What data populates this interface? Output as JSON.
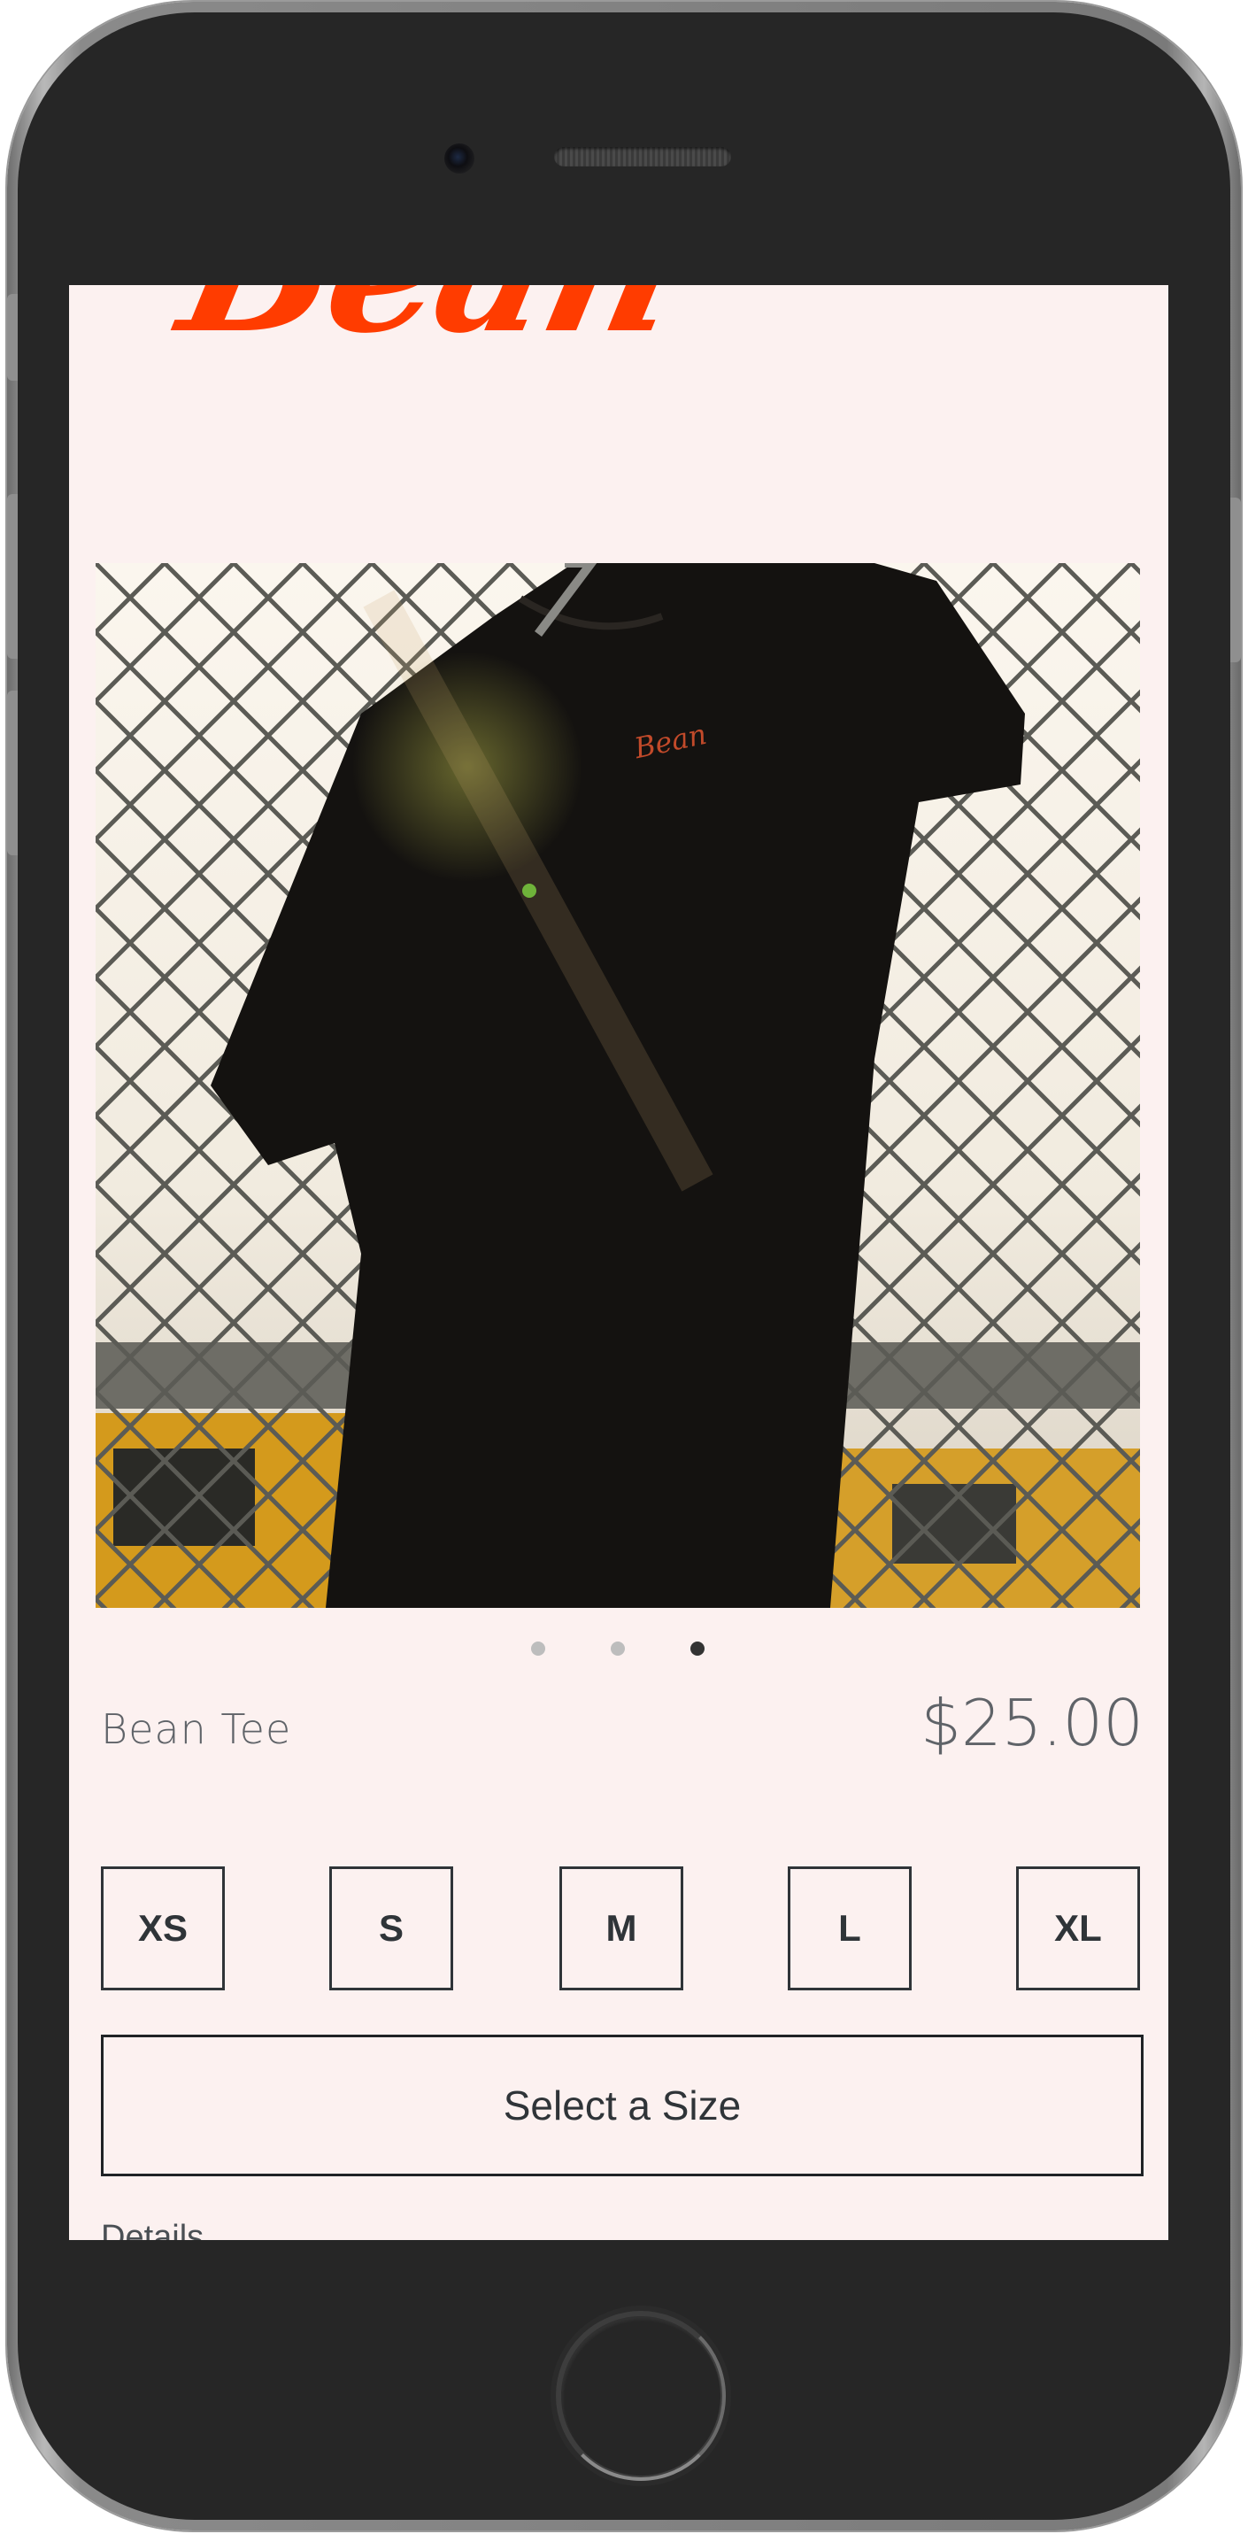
{
  "brand": {
    "logo_text": "Bean"
  },
  "product": {
    "name": "Bean Tee",
    "price": "$25.00",
    "image_shirt_print": "Bean"
  },
  "carousel": {
    "count": 3,
    "active_index": 2
  },
  "sizes": [
    "XS",
    "S",
    "M",
    "L",
    "XL"
  ],
  "select_button_label": "Select a Size",
  "details_label": "Details",
  "colors": {
    "accent": "#ff3c00",
    "background": "#fcf1f0",
    "text": "#2f3438"
  }
}
